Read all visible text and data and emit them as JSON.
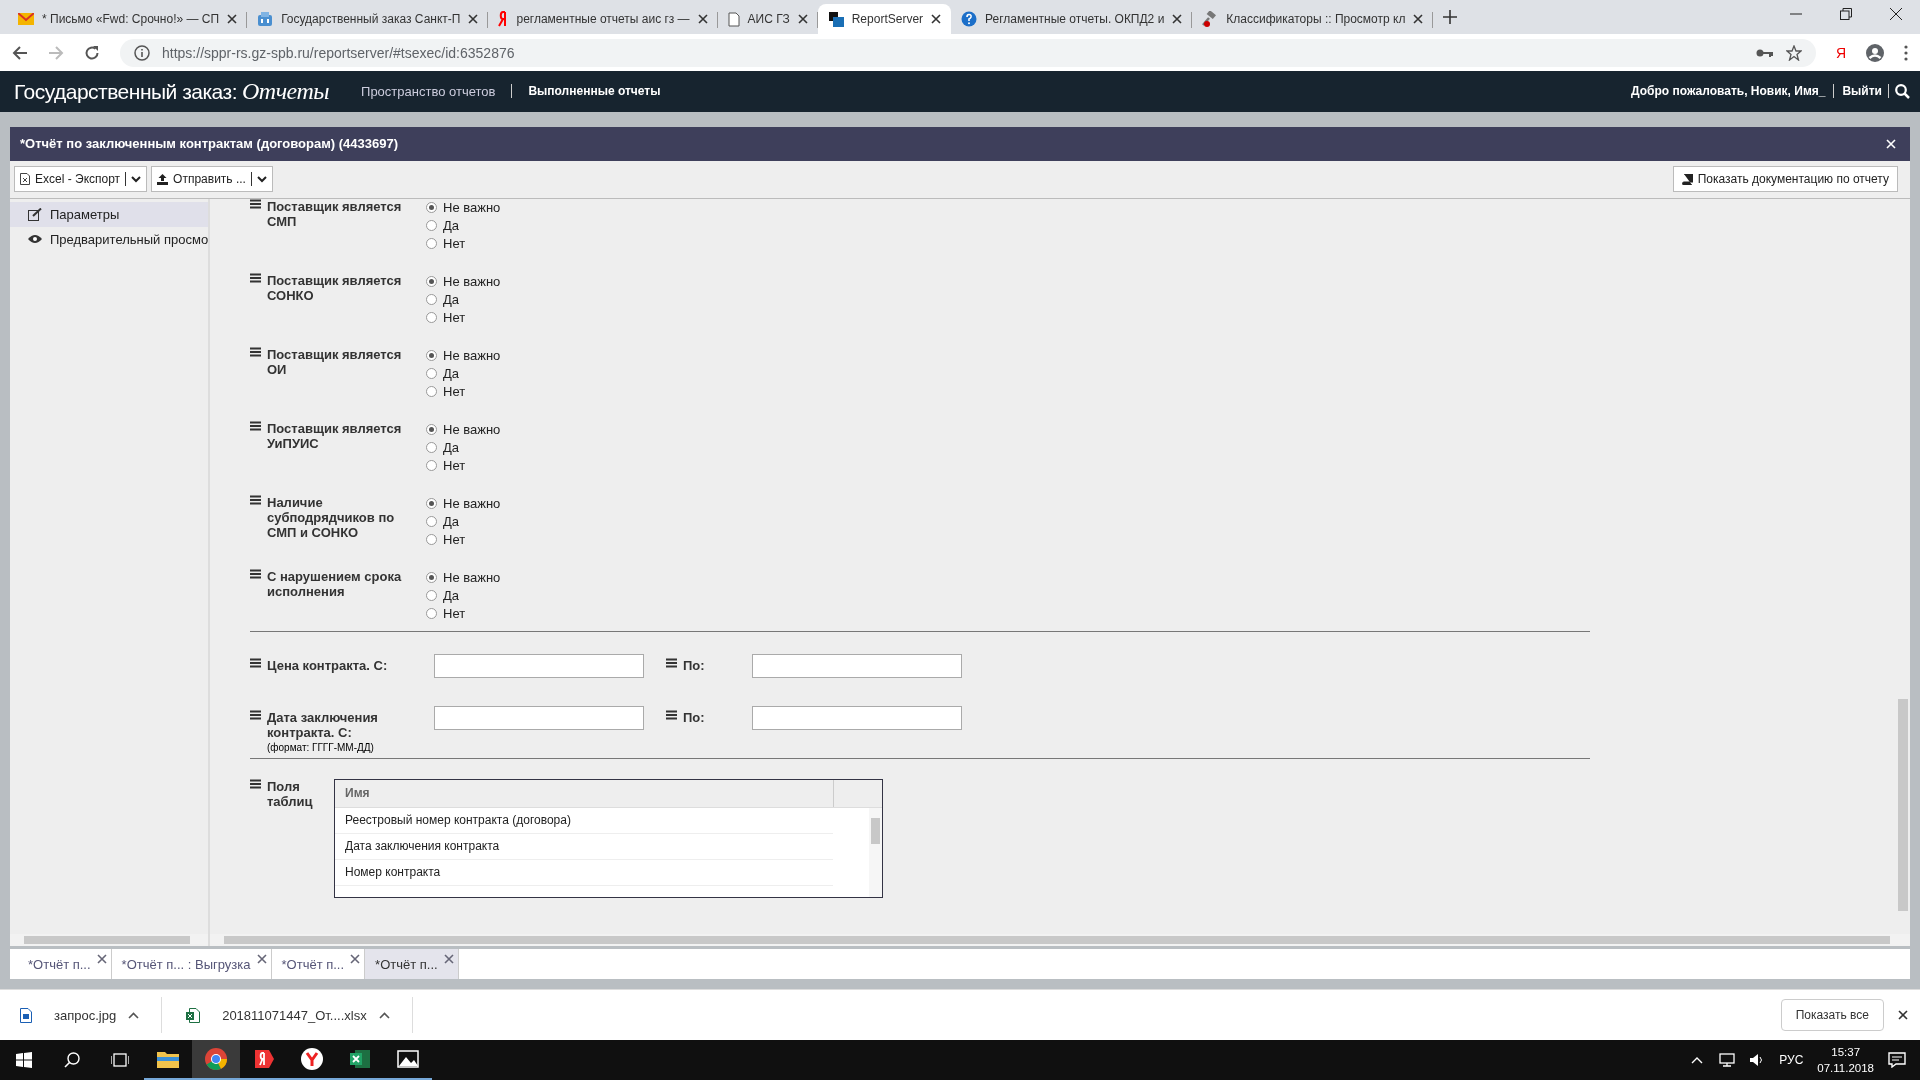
{
  "browser": {
    "tabs": [
      {
        "title": "* Письмо «Fwd: Срочно!» — СП",
        "selected": false
      },
      {
        "title": "Государственный заказ Санкт-П",
        "selected": false
      },
      {
        "title": "регламентные отчеты аис гз —",
        "selected": false
      },
      {
        "title": "АИС ГЗ",
        "selected": false
      },
      {
        "title": "ReportServer",
        "selected": true
      },
      {
        "title": "Регламентные отчеты. ОКПД2 и",
        "selected": false
      },
      {
        "title": "Классификаторы :: Просмотр кл",
        "selected": false
      }
    ],
    "url": "https://sppr-rs.gz-spb.ru/reportserver/#tsexec/id:6352876",
    "extension": "Я"
  },
  "app_header": {
    "logo": "Государственный заказ:",
    "logo_script": "Отчеты",
    "nav": [
      {
        "label": "Пространство отчетов",
        "selected": false
      },
      {
        "label": "Выполненные отчеты",
        "selected": true
      }
    ],
    "greeting": "Добро пожаловать, Новик, Имя_",
    "logout": "Выйти"
  },
  "report": {
    "title": "*Отчёт по заключенным контрактам (договорам) (4433697)",
    "toolbar": {
      "export": "Excel - Экспорт",
      "send": "Отправить ...",
      "docs": "Показать документацию по отчету"
    },
    "sidebar": [
      {
        "label": "Параметры",
        "selected": true
      },
      {
        "label": "Предварительный просмо",
        "selected": false
      }
    ],
    "radio_params": [
      {
        "label": "Поставщик является СМП",
        "options": [
          {
            "label": "Не важно",
            "selected": true
          },
          {
            "label": "Да",
            "selected": false
          },
          {
            "label": "Нет",
            "selected": false
          }
        ]
      },
      {
        "label": "Поставщик является СОНКО",
        "options": [
          {
            "label": "Не важно",
            "selected": true
          },
          {
            "label": "Да",
            "selected": false
          },
          {
            "label": "Нет",
            "selected": false
          }
        ]
      },
      {
        "label": "Поставщик является ОИ",
        "options": [
          {
            "label": "Не важно",
            "selected": true
          },
          {
            "label": "Да",
            "selected": false
          },
          {
            "label": "Нет",
            "selected": false
          }
        ]
      },
      {
        "label": "Поставщик является УиПУИС",
        "options": [
          {
            "label": "Не важно",
            "selected": true
          },
          {
            "label": "Да",
            "selected": false
          },
          {
            "label": "Нет",
            "selected": false
          }
        ]
      },
      {
        "label": "Наличие субподрядчиков по СМП и СОНКО",
        "options": [
          {
            "label": "Не важно",
            "selected": true
          },
          {
            "label": "Да",
            "selected": false
          },
          {
            "label": "Нет",
            "selected": false
          }
        ]
      },
      {
        "label": "С нарушением срока исполнения",
        "options": [
          {
            "label": "Не важно",
            "selected": true
          },
          {
            "label": "Да",
            "selected": false
          },
          {
            "label": "Нет",
            "selected": false
          }
        ]
      }
    ],
    "range_params": [
      {
        "label": "Цена контракта. С:",
        "to_label": "По:"
      },
      {
        "label": "Дата заключения контракта. С:",
        "hint": "(формат: ГГГГ-ММ-ДД)",
        "to_label": "По:"
      }
    ],
    "fields_param": {
      "label": "Поля таблиц",
      "column": "Имя",
      "rows": [
        "Реестровый номер контракта (договора)",
        "Дата заключения контракта",
        "Номер контракта"
      ]
    }
  },
  "report_tabs": [
    {
      "label": "*Отчёт п...",
      "selected": false
    },
    {
      "label": "*Отчёт п... : Выгрузка",
      "selected": false
    },
    {
      "label": "*Отчёт п...",
      "selected": false
    },
    {
      "label": "*Отчёт п...",
      "selected": true
    }
  ],
  "downloads": {
    "files": [
      {
        "name": "запрос.jpg",
        "kind": "image"
      },
      {
        "name": "201811071447_От....xlsx",
        "kind": "excel"
      }
    ],
    "show_all": "Показать все"
  },
  "taskbar": {
    "apps": [
      {
        "kind": "explorer",
        "selected": false
      },
      {
        "kind": "chrome",
        "selected": true
      },
      {
        "kind": "yandex",
        "selected": false
      },
      {
        "kind": "ybrowser",
        "selected": false
      },
      {
        "kind": "excel",
        "selected": false
      },
      {
        "kind": "photos",
        "selected": false
      }
    ],
    "language": "РУС",
    "time": "15:37",
    "date": "07.11.2018"
  }
}
